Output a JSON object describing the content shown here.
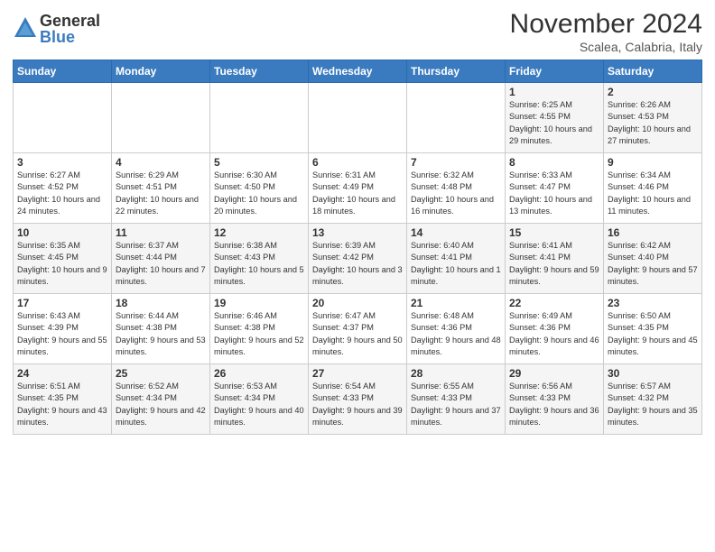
{
  "logo": {
    "general": "General",
    "blue": "Blue"
  },
  "header": {
    "month": "November 2024",
    "location": "Scalea, Calabria, Italy"
  },
  "weekdays": [
    "Sunday",
    "Monday",
    "Tuesday",
    "Wednesday",
    "Thursday",
    "Friday",
    "Saturday"
  ],
  "weeks": [
    [
      {
        "day": "",
        "info": ""
      },
      {
        "day": "",
        "info": ""
      },
      {
        "day": "",
        "info": ""
      },
      {
        "day": "",
        "info": ""
      },
      {
        "day": "",
        "info": ""
      },
      {
        "day": "1",
        "info": "Sunrise: 6:25 AM\nSunset: 4:55 PM\nDaylight: 10 hours\nand 29 minutes."
      },
      {
        "day": "2",
        "info": "Sunrise: 6:26 AM\nSunset: 4:53 PM\nDaylight: 10 hours\nand 27 minutes."
      }
    ],
    [
      {
        "day": "3",
        "info": "Sunrise: 6:27 AM\nSunset: 4:52 PM\nDaylight: 10 hours\nand 24 minutes."
      },
      {
        "day": "4",
        "info": "Sunrise: 6:29 AM\nSunset: 4:51 PM\nDaylight: 10 hours\nand 22 minutes."
      },
      {
        "day": "5",
        "info": "Sunrise: 6:30 AM\nSunset: 4:50 PM\nDaylight: 10 hours\nand 20 minutes."
      },
      {
        "day": "6",
        "info": "Sunrise: 6:31 AM\nSunset: 4:49 PM\nDaylight: 10 hours\nand 18 minutes."
      },
      {
        "day": "7",
        "info": "Sunrise: 6:32 AM\nSunset: 4:48 PM\nDaylight: 10 hours\nand 16 minutes."
      },
      {
        "day": "8",
        "info": "Sunrise: 6:33 AM\nSunset: 4:47 PM\nDaylight: 10 hours\nand 13 minutes."
      },
      {
        "day": "9",
        "info": "Sunrise: 6:34 AM\nSunset: 4:46 PM\nDaylight: 10 hours\nand 11 minutes."
      }
    ],
    [
      {
        "day": "10",
        "info": "Sunrise: 6:35 AM\nSunset: 4:45 PM\nDaylight: 10 hours\nand 9 minutes."
      },
      {
        "day": "11",
        "info": "Sunrise: 6:37 AM\nSunset: 4:44 PM\nDaylight: 10 hours\nand 7 minutes."
      },
      {
        "day": "12",
        "info": "Sunrise: 6:38 AM\nSunset: 4:43 PM\nDaylight: 10 hours\nand 5 minutes."
      },
      {
        "day": "13",
        "info": "Sunrise: 6:39 AM\nSunset: 4:42 PM\nDaylight: 10 hours\nand 3 minutes."
      },
      {
        "day": "14",
        "info": "Sunrise: 6:40 AM\nSunset: 4:41 PM\nDaylight: 10 hours\nand 1 minute."
      },
      {
        "day": "15",
        "info": "Sunrise: 6:41 AM\nSunset: 4:41 PM\nDaylight: 9 hours\nand 59 minutes."
      },
      {
        "day": "16",
        "info": "Sunrise: 6:42 AM\nSunset: 4:40 PM\nDaylight: 9 hours\nand 57 minutes."
      }
    ],
    [
      {
        "day": "17",
        "info": "Sunrise: 6:43 AM\nSunset: 4:39 PM\nDaylight: 9 hours\nand 55 minutes."
      },
      {
        "day": "18",
        "info": "Sunrise: 6:44 AM\nSunset: 4:38 PM\nDaylight: 9 hours\nand 53 minutes."
      },
      {
        "day": "19",
        "info": "Sunrise: 6:46 AM\nSunset: 4:38 PM\nDaylight: 9 hours\nand 52 minutes."
      },
      {
        "day": "20",
        "info": "Sunrise: 6:47 AM\nSunset: 4:37 PM\nDaylight: 9 hours\nand 50 minutes."
      },
      {
        "day": "21",
        "info": "Sunrise: 6:48 AM\nSunset: 4:36 PM\nDaylight: 9 hours\nand 48 minutes."
      },
      {
        "day": "22",
        "info": "Sunrise: 6:49 AM\nSunset: 4:36 PM\nDaylight: 9 hours\nand 46 minutes."
      },
      {
        "day": "23",
        "info": "Sunrise: 6:50 AM\nSunset: 4:35 PM\nDaylight: 9 hours\nand 45 minutes."
      }
    ],
    [
      {
        "day": "24",
        "info": "Sunrise: 6:51 AM\nSunset: 4:35 PM\nDaylight: 9 hours\nand 43 minutes."
      },
      {
        "day": "25",
        "info": "Sunrise: 6:52 AM\nSunset: 4:34 PM\nDaylight: 9 hours\nand 42 minutes."
      },
      {
        "day": "26",
        "info": "Sunrise: 6:53 AM\nSunset: 4:34 PM\nDaylight: 9 hours\nand 40 minutes."
      },
      {
        "day": "27",
        "info": "Sunrise: 6:54 AM\nSunset: 4:33 PM\nDaylight: 9 hours\nand 39 minutes."
      },
      {
        "day": "28",
        "info": "Sunrise: 6:55 AM\nSunset: 4:33 PM\nDaylight: 9 hours\nand 37 minutes."
      },
      {
        "day": "29",
        "info": "Sunrise: 6:56 AM\nSunset: 4:33 PM\nDaylight: 9 hours\nand 36 minutes."
      },
      {
        "day": "30",
        "info": "Sunrise: 6:57 AM\nSunset: 4:32 PM\nDaylight: 9 hours\nand 35 minutes."
      }
    ]
  ]
}
